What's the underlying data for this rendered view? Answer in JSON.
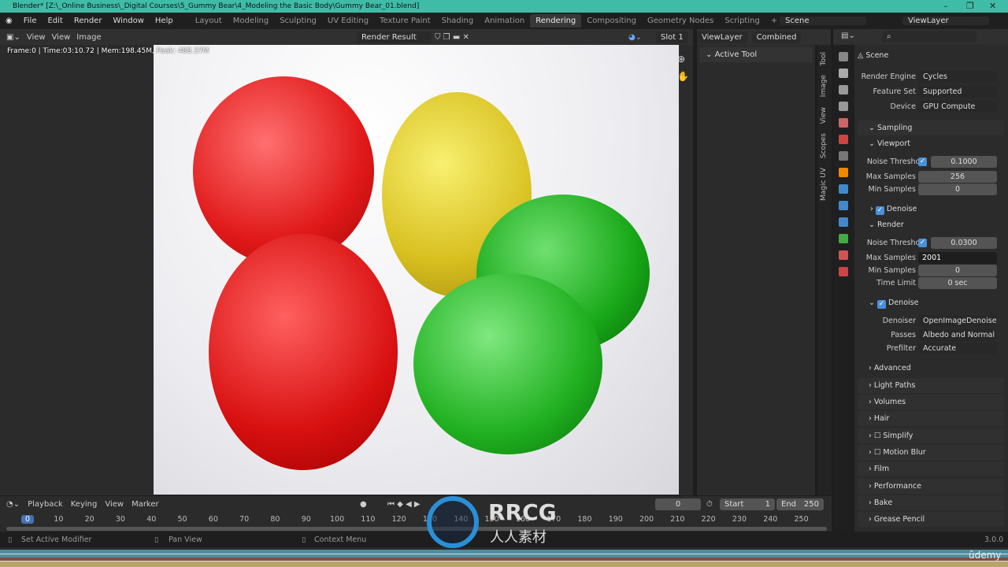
{
  "title_bar": {
    "text": "Blender* [Z:\\_Online Business\\_Digital Courses\\5_Gummy Bear\\4_Modeling the Basic Body\\Gummy Bear_01.blend]",
    "minimize": "–",
    "maximize": "❐",
    "close": "✕"
  },
  "menu": [
    "File",
    "Edit",
    "Render",
    "Window",
    "Help"
  ],
  "workspaces": [
    "Layout",
    "Modeling",
    "Sculpting",
    "UV Editing",
    "Texture Paint",
    "Shading",
    "Animation",
    "Rendering",
    "Compositing",
    "Geometry Nodes",
    "Scripting",
    "+"
  ],
  "active_workspace": "Rendering",
  "scene": "Scene",
  "view_layer": "ViewLayer",
  "image_editor": {
    "view_dd": "View",
    "view": "View",
    "image": "Image",
    "image_name": "Render Result",
    "slot": "Slot 1",
    "layer": "ViewLayer",
    "pass": "Combined",
    "stats": "Frame:0 | Time:03:10.72 | Mem:198.45M, Peak: 488.37M"
  },
  "tool_panel": {
    "header": "Active Tool",
    "tabs": [
      "Tool",
      "Image",
      "View",
      "Scopes",
      "Magic UV"
    ]
  },
  "properties": {
    "context": "Scene",
    "render_engine": {
      "label": "Render Engine",
      "value": "Cycles"
    },
    "feature_set": {
      "label": "Feature Set",
      "value": "Supported"
    },
    "device": {
      "label": "Device",
      "value": "GPU Compute"
    },
    "sampling": "Sampling",
    "viewport": {
      "title": "Viewport",
      "noise_label": "Noise Threshol",
      "noise": "0.1000",
      "max_label": "Max Samples",
      "max": "256",
      "min_label": "Min Samples",
      "min": "0",
      "denoise": "Denoise"
    },
    "render": {
      "title": "Render",
      "noise_label": "Noise Threshol",
      "noise": "0.0300",
      "max_label": "Max Samples",
      "max": "2001",
      "min_label": "Min Samples",
      "min": "0",
      "time_label": "Time Limit",
      "time": "0 sec",
      "denoise": "Denoise",
      "denoiser_label": "Denoiser",
      "denoiser": "OpenImageDenoise",
      "passes_label": "Passes",
      "passes": "Albedo and Normal",
      "prefilter_label": "Prefilter",
      "prefilter": "Accurate"
    },
    "advanced": "Advanced",
    "panels": [
      "Light Paths",
      "Volumes",
      "Hair",
      "Simplify",
      "Motion Blur",
      "Film",
      "Performance",
      "Bake",
      "Grease Pencil"
    ]
  },
  "timeline": {
    "playback": "Playback",
    "keying": "Keying",
    "view": "View",
    "marker": "Marker",
    "current": "0",
    "start_label": "Start",
    "start": "1",
    "end_label": "End",
    "end": "250",
    "ticks": [
      "0",
      "10",
      "20",
      "30",
      "40",
      "50",
      "60",
      "70",
      "80",
      "90",
      "100",
      "110",
      "120",
      "130",
      "140",
      "150",
      "160",
      "170",
      "180",
      "190",
      "200",
      "210",
      "220",
      "230",
      "240",
      "250"
    ]
  },
  "status": {
    "left": "Set Active Modifier",
    "mid": "Pan View",
    "right": "Context Menu",
    "version": "3.0.0"
  },
  "watermark": {
    "brand": "RRCG",
    "sub": "人人素材",
    "udemy": "ûdemy"
  }
}
